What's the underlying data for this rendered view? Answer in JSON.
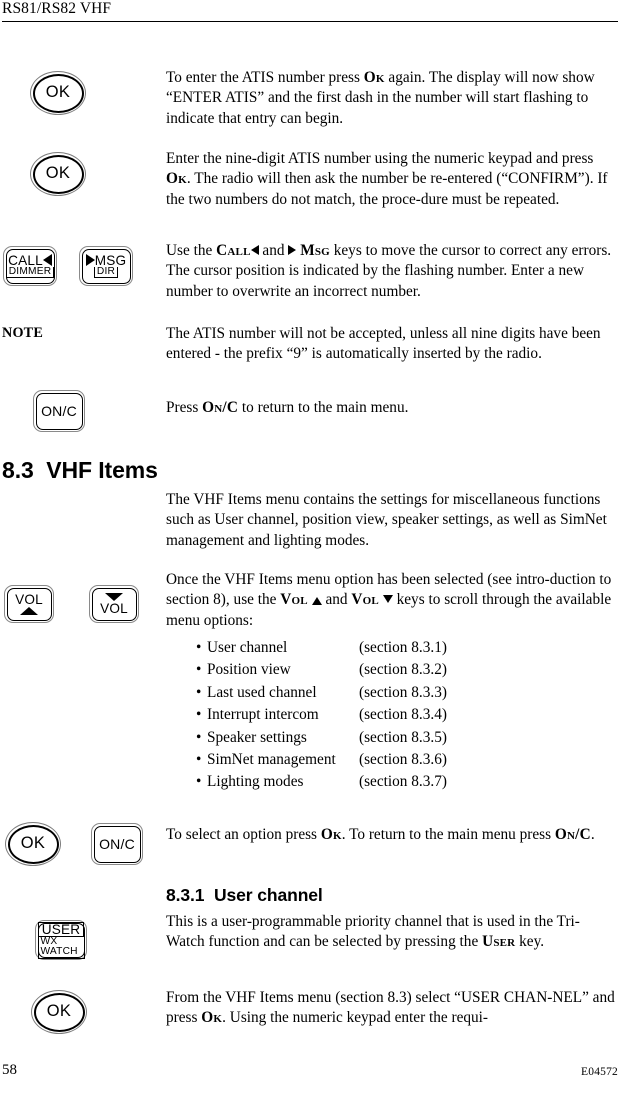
{
  "header": {
    "title": "RS81/RS82 VHF"
  },
  "paragraphs": {
    "p1_a": "To enter the ATIS number press ",
    "p1_key": "Ok",
    "p1_b": " again. The display will now show “ENTER ATIS” and the first dash in the number will start flashing to indicate that entry can begin.",
    "p2_a": "Enter the nine-digit ATIS number using the numeric keypad and press ",
    "p2_key": "Ok",
    "p2_b": ". The radio will then ask the number be re-entered (“CONFIRM”). If the two numbers do not match, the proce-dure must be repeated.",
    "p3_a": "Use the ",
    "p3_key1": "Call",
    "p3_mid": " and ",
    "p3_key2": "Msg",
    "p3_b": " keys to move the cursor to correct any errors. The cursor position is indicated by the flashing number. Enter a new number to overwrite an incorrect number.",
    "note_label": "NOTE",
    "note_text": "The ATIS number will not be accepted, unless all nine digits have been entered - the prefix “9” is automatically inserted by the radio.",
    "p5_a": "Press ",
    "p5_key": "On/C",
    "p5_b": " to return to the main menu.",
    "p6": "The VHF Items menu contains the settings for miscellaneous functions such as User channel, position view, speaker settings, as well as SimNet management and lighting modes.",
    "p7_a": "Once the VHF Items menu option has been selected (see intro-duction to section 8), use the ",
    "p7_key1": "Vol",
    "p7_mid": " and ",
    "p7_key2": "Vol",
    "p7_b": " keys to scroll through the available menu options:",
    "p8_a": "To select an option press ",
    "p8_key1": "Ok",
    "p8_mid": ". To return to the main menu press ",
    "p8_key2": "On/C",
    "p8_b": ".",
    "p9_a": "This is a user-programmable priority channel that is used in the Tri-Watch function and can be selected by pressing the ",
    "p9_key": "User",
    "p9_b": " key.",
    "p10_a": "From the VHF Items menu (section 8.3) select “USER CHAN-NEL” and press ",
    "p10_key": "Ok",
    "p10_b": ". Using the numeric keypad enter the requi-"
  },
  "headings": {
    "h_83_num": "8.3",
    "h_83_title": "VHF Items",
    "h_831_num": "8.3.1",
    "h_831_title": "User channel"
  },
  "menu_options": [
    {
      "bullet": "•",
      "label": "User channel",
      "ref": "(section 8.3.1)"
    },
    {
      "bullet": "•",
      "label": "Position view",
      "ref": "(section 8.3.2)"
    },
    {
      "bullet": "•",
      "label": "Last used channel",
      "ref": "(section 8.3.3)"
    },
    {
      "bullet": "•",
      "label": "Interrupt intercom",
      "ref": "(section 8.3.4)"
    },
    {
      "bullet": "•",
      "label": "Speaker settings",
      "ref": "(section 8.3.5)"
    },
    {
      "bullet": "•",
      "label": "SimNet management",
      "ref": "(section 8.3.6)"
    },
    {
      "bullet": "•",
      "label": "Lighting modes",
      "ref": "(section 8.3.7)"
    }
  ],
  "keys": {
    "ok": "OK",
    "onc": "ON/C",
    "call_main": "CALL",
    "call_sub": "DIMMER",
    "msg_main": "MSG",
    "msg_sub": "DIR",
    "vol": "VOL",
    "user_main": "USER",
    "user_sub": "WX WATCH"
  },
  "footer": {
    "page_number": "58",
    "doc_code": "E04572"
  }
}
